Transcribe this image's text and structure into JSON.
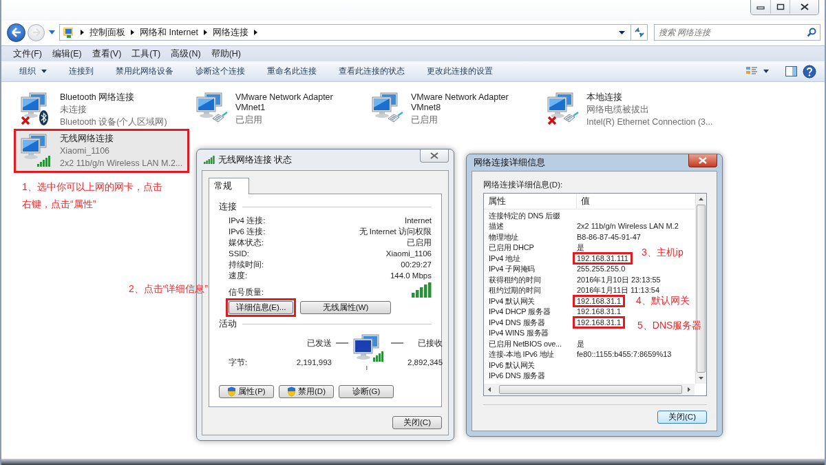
{
  "window": {
    "breadcrumbs": [
      "控制面板",
      "网络和 Internet",
      "网络连接"
    ],
    "search": {
      "placeholder": "搜索 网络连接"
    }
  },
  "menu": [
    "文件(F)",
    "编辑(E)",
    "查看(V)",
    "工具(T)",
    "高级(N)",
    "帮助(H)"
  ],
  "toolbar": [
    {
      "label": "组织",
      "dropdown": true
    },
    {
      "label": "连接到",
      "dropdown": false
    },
    {
      "label": "禁用此网络设备",
      "dropdown": false
    },
    {
      "label": "诊断这个连接",
      "dropdown": false
    },
    {
      "label": "重命名此连接",
      "dropdown": false
    },
    {
      "label": "查看此连接的状态",
      "dropdown": false
    },
    {
      "label": "更改此连接的设置",
      "dropdown": false
    }
  ],
  "adapters": [
    {
      "name": "Bluetooth 网络连接",
      "status": "未连接",
      "device": "Bluetooth 设备(个人区域网)",
      "badges": [
        {
          "kind": "x"
        },
        {
          "kind": "bluetooth"
        }
      ],
      "selected": false,
      "highlighted": false
    },
    {
      "name": "VMware Network Adapter VMnet1",
      "status": "已启用",
      "badges": [
        {
          "kind": "cable"
        }
      ],
      "selected": false,
      "highlighted": false
    },
    {
      "name": "VMware Network Adapter VMnet8",
      "status": "已启用",
      "badges": [
        {
          "kind": "cable"
        }
      ],
      "selected": false,
      "highlighted": false
    },
    {
      "name": "本地连接",
      "status": "网络电缆被拔出",
      "device": "Intel(R) Ethernet Connection (3...",
      "badges": [
        {
          "kind": "x"
        },
        {
          "kind": "cable"
        }
      ],
      "selected": false,
      "highlighted": false
    },
    {
      "name": "无线网络连接",
      "status": "Xiaomi_1106",
      "device": "2x2 11b/g/n Wireless LAN M.2...",
      "badges": [
        {
          "kind": "signal"
        }
      ],
      "selected": true,
      "highlighted": true
    }
  ],
  "status_dialog": {
    "title": "无线网络连接 状态",
    "tabs": [
      {
        "label": "常规",
        "selected": true
      }
    ],
    "connection_heading": "连接",
    "rows": [
      {
        "label": "IPv4 连接:",
        "value": "Internet"
      },
      {
        "label": "IPv6 连接:",
        "value": "无 Internet 访问权限"
      },
      {
        "label": "媒体状态:",
        "value": "已启用"
      },
      {
        "label": "SSID:",
        "value": "Xiaomi_1106"
      },
      {
        "label": "持续时间:",
        "value": "00:29:27"
      },
      {
        "label": "速度:",
        "value": "144.0 Mbps"
      }
    ],
    "signal_label": "信号质量:",
    "buttons": [
      {
        "label": "详细信息(E)...",
        "highlighted": true
      },
      {
        "label": "无线属性(W)",
        "highlighted": false
      }
    ],
    "activity_heading": "活动",
    "sent_label": "已发送",
    "received_label": "已接收",
    "bytes_label": "字节:",
    "bytes_sent": "2,191,993",
    "bytes_received": "2,892,345",
    "actions": [
      {
        "label": "属性(P)",
        "shield": true
      },
      {
        "label": "禁用(D)",
        "shield": true
      },
      {
        "label": "诊断(G)",
        "shield": false
      }
    ],
    "close": "关闭(C)"
  },
  "details_dialog": {
    "title": "网络连接详细信息",
    "list_label": "网络连接详细信息(D):",
    "columns": [
      "属性",
      "值"
    ],
    "rows": [
      {
        "property": "连接特定的 DNS 后缀"
      },
      {
        "property": "描述",
        "value": "2x2 11b/g/n Wireless LAN M.2",
        "highlighted": false
      },
      {
        "property": "物理地址",
        "value": "B8-86-87-45-91-47",
        "highlighted": false
      },
      {
        "property": "已启用 DHCP",
        "value": "是",
        "highlighted": false
      },
      {
        "property": "IPv4 地址",
        "value": "192.168.31.111",
        "highlighted": true
      },
      {
        "property": "IPv4 子网掩码",
        "value": "255.255.255.0",
        "highlighted": false
      },
      {
        "property": "获得租约的时间",
        "value": "2016年1月10日 23:13:55",
        "highlighted": false
      },
      {
        "property": "租约过期的时间",
        "value": "2016年1月11日 11:13:54",
        "highlighted": false
      },
      {
        "property": "IPv4 默认网关",
        "value": "192.168.31.1",
        "highlighted": true
      },
      {
        "property": "IPv4 DHCP 服务器",
        "value": "192.168.31.1",
        "highlighted": false
      },
      {
        "property": "IPv4 DNS 服务器",
        "value": "192.168.31.1",
        "highlighted": true
      },
      {
        "property": "IPv4 WINS 服务器"
      },
      {
        "property": "已启用 NetBIOS ove...",
        "value": "是",
        "highlighted": false
      },
      {
        "property": "连接-本地 IPv6 地址",
        "value": "fe80::1155:b455:7:8659%13",
        "highlighted": false
      },
      {
        "property": "IPv6 默认网关"
      },
      {
        "property": "IPv6 DNS 服务器"
      }
    ],
    "close": "关闭(C)"
  },
  "notes": [
    {
      "text": "1、选中你可以上网的网卡，点击右键，点击“属性”"
    },
    {
      "text": "2、点击“详细信息”"
    },
    {
      "text": "3、主机ip"
    },
    {
      "text": "4、默认网关"
    },
    {
      "text": "5、DNS服务器"
    }
  ]
}
